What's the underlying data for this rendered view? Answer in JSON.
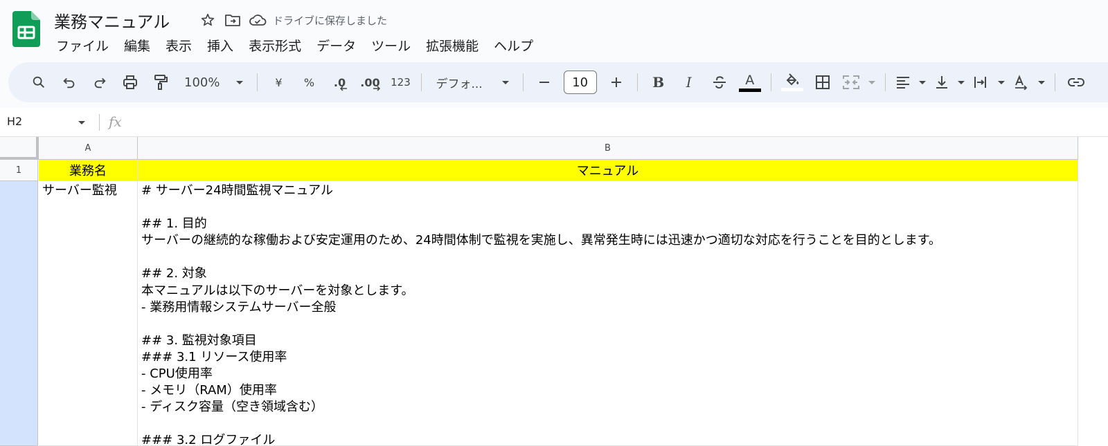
{
  "app": {
    "title": "業務マニュアル",
    "save_status": "ドライブに保存しました"
  },
  "menu": [
    "ファイル",
    "編集",
    "表示",
    "挿入",
    "表示形式",
    "データ",
    "ツール",
    "拡張機能",
    "ヘルプ"
  ],
  "toolbar": {
    "zoom": "100%",
    "currency": "¥",
    "percent": "%",
    "decimal_decrease": ".0",
    "decimal_increase": ".00",
    "number_format": "123",
    "font_name": "デフォ...",
    "font_size": "10",
    "bold": "B",
    "italic": "I",
    "text_color_letter": "A",
    "text_color_bar": "#000000"
  },
  "formula_bar": {
    "cell_ref": "H2",
    "fx": "fx",
    "content": ""
  },
  "sheet": {
    "columns": [
      "A",
      "B"
    ],
    "rows": [
      {
        "number": "1",
        "a": "業務名",
        "b": "マニュアル"
      },
      {
        "number": "",
        "a": "サーバー監視",
        "b": "# サーバー24時間監視マニュアル\n\n## 1. 目的\nサーバーの継続的な稼働および安定運用のため、24時間体制で監視を実施し、異常発生時には迅速かつ適切な対応を行うことを目的とします。\n\n## 2. 対象\n本マニュアルは以下のサーバーを対象とします。\n- 業務用情報システムサーバー全般\n\n## 3. 監視対象項目\n### 3.1 リソース使用率\n- CPU使用率\n- メモリ（RAM）使用率\n- ディスク容量（空き領域含む）\n\n### 3.2 ログファイル"
      }
    ]
  },
  "colors": {
    "header_fill": "#ffff00",
    "selected_row": "#d3e3fd",
    "toolbar_bg": "#edf2fa",
    "sheets_green": "#0f9d58"
  }
}
